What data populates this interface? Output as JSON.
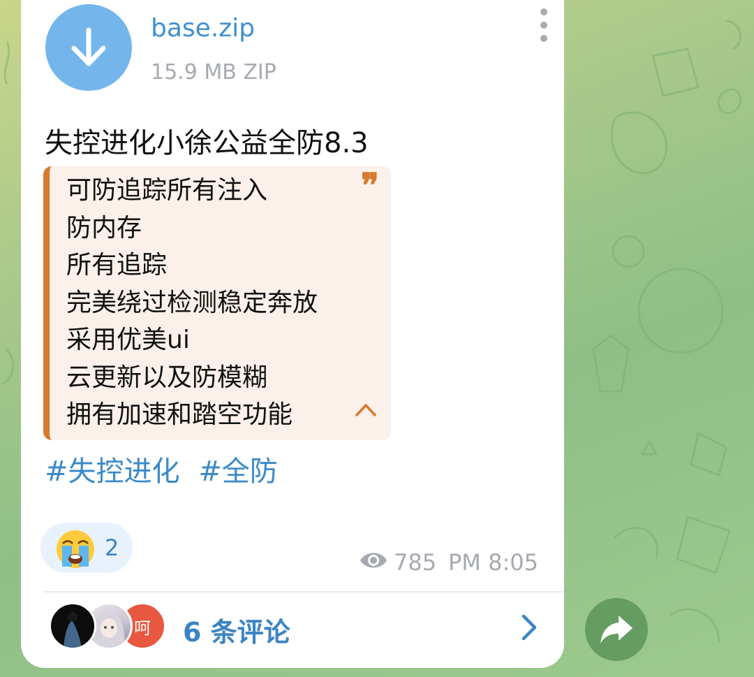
{
  "file": {
    "name": "base.zip",
    "meta": "15.9 MB ZIP"
  },
  "post": {
    "title": "失控进化小徐公益全防8.3",
    "quote_lines": [
      "可防追踪所有注入",
      "防内存",
      "所有追踪",
      "完美绕过检测稳定奔放",
      "采用优美ui",
      "云更新以及防模糊",
      "拥有加速和踏空功能"
    ],
    "quote_mark": "❞",
    "hashtags": [
      "#失控进化",
      "#全防"
    ]
  },
  "reaction": {
    "emoji": "crying-face-icon",
    "count": "2"
  },
  "footer": {
    "views": "785",
    "time": "PM 8:05"
  },
  "comments": {
    "avatar_3_text": "呵",
    "label": "6 条评论"
  },
  "colors": {
    "accent_blue": "#3a84c4",
    "quote_orange": "#d8792c",
    "file_icon_blue": "#74b6ec",
    "share_green": "#5d965c"
  }
}
